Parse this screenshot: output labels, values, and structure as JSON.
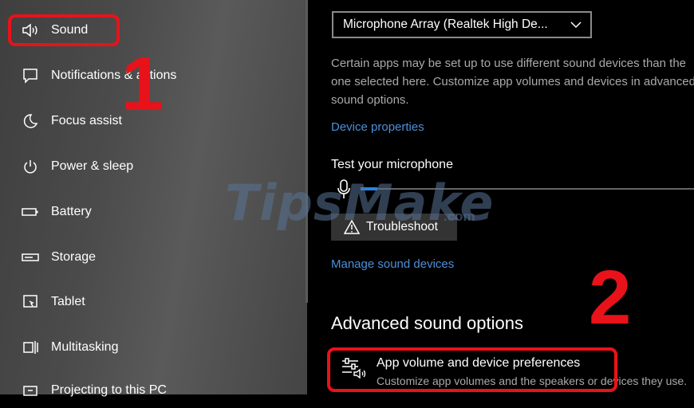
{
  "sidebar": {
    "items": [
      {
        "label": "Sound",
        "icon": "speaker-icon"
      },
      {
        "label": "Notifications & actions",
        "icon": "notification-icon"
      },
      {
        "label": "Focus assist",
        "icon": "moon-icon"
      },
      {
        "label": "Power & sleep",
        "icon": "power-icon"
      },
      {
        "label": "Battery",
        "icon": "battery-icon"
      },
      {
        "label": "Storage",
        "icon": "storage-icon"
      },
      {
        "label": "Tablet",
        "icon": "tablet-icon"
      },
      {
        "label": "Multitasking",
        "icon": "multitasking-icon"
      },
      {
        "label": "Projecting to this PC",
        "icon": "projecting-icon"
      }
    ]
  },
  "main": {
    "input_device": "Microphone Array (Realtek High De...",
    "description": "Certain apps may be set up to use different sound devices than the one selected here. Customize app volumes and devices in advanced sound options.",
    "device_properties_link": "Device properties",
    "test_heading": "Test your microphone",
    "mic_level_fraction": 0.05,
    "troubleshoot_label": "Troubleshoot",
    "manage_link": "Manage sound devices",
    "advanced_heading": "Advanced sound options",
    "app_volume_title": "App volume and device preferences",
    "app_volume_sub": "Customize app volumes and the speakers or devices they use."
  },
  "callouts": {
    "step1": "1",
    "step2": "2",
    "color": "#e8121a"
  },
  "watermark": {
    "text": "TipsMake",
    "suffix": ".com"
  },
  "colors": {
    "link": "#4d8fd9",
    "accent": "#2a83e0"
  }
}
